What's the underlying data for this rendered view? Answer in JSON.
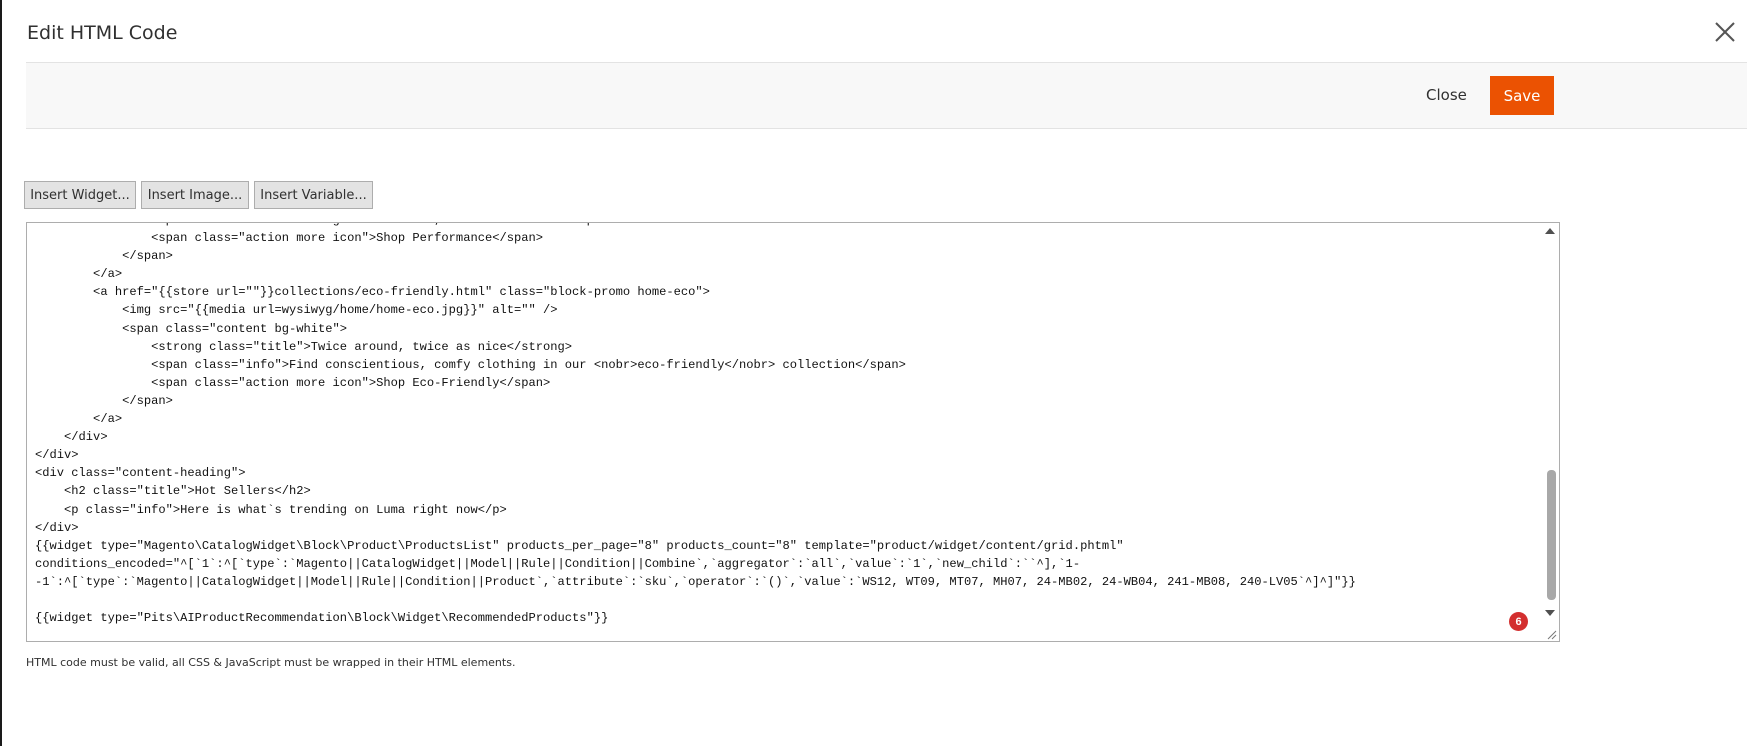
{
  "modal": {
    "title": "Edit HTML Code",
    "close_label": "Close",
    "save_label": "Save",
    "accent_color": "#eb5202"
  },
  "toolbar": {
    "buttons": [
      "Insert Widget...",
      "Insert Image...",
      "Insert Variable..."
    ]
  },
  "editor": {
    "lines": [
      "                <span class=\"info\">Wicking to cool down, Luma Performance</span>",
      "                <span class=\"action more icon\">Shop Performance</span>",
      "            </span>",
      "        </a>",
      "        <a href=\"{{store url=\"\"}}collections/eco-friendly.html\" class=\"block-promo home-eco\">",
      "            <img src=\"{{media url=wysiwyg/home/home-eco.jpg}}\" alt=\"\" />",
      "            <span class=\"content bg-white\">",
      "                <strong class=\"title\">Twice around, twice as nice</strong>",
      "                <span class=\"info\">Find conscientious, comfy clothing in our <nobr>eco-friendly</nobr> collection</span>",
      "                <span class=\"action more icon\">Shop Eco-Friendly</span>",
      "            </span>",
      "        </a>",
      "    </div>",
      "</div>",
      "<div class=\"content-heading\">",
      "    <h2 class=\"title\">Hot Sellers</h2>",
      "    <p class=\"info\">Here is what`s trending on Luma right now</p>",
      "</div>",
      "{{widget type=\"Magento\\CatalogWidget\\Block\\Product\\ProductsList\" products_per_page=\"8\" products_count=\"8\" template=\"product/widget/content/grid.phtml\"",
      "conditions_encoded=\"^[`1`:^[`type`:`Magento||CatalogWidget||Model||Rule||Condition||Combine`,`aggregator`:`all`,`value`:`1`,`new_child`:``^],`1-",
      "-1`:^[`type`:`Magento||CatalogWidget||Model||Rule||Condition||Product`,`attribute`:`sku`,`operator`:`()`,`value`:`WS12, WT09, MT07, MH07, 24-MB02, 24-WB04, 241-MB08, 240-LV05`^]^]\"}}",
      "",
      "{{widget type=\"Pits\\AIProductRecommendation\\Block\\Widget\\RecommendedProducts\"}}"
    ]
  },
  "badge": {
    "count": "6",
    "color": "#d32f2f"
  },
  "note": "HTML code must be valid, all CSS & JavaScript must be wrapped in their HTML elements.",
  "icons": {
    "close": "close-x-icon",
    "scroll_up": "arrow-up-icon",
    "scroll_down": "arrow-down-icon",
    "resize": "resize-grip-icon"
  }
}
